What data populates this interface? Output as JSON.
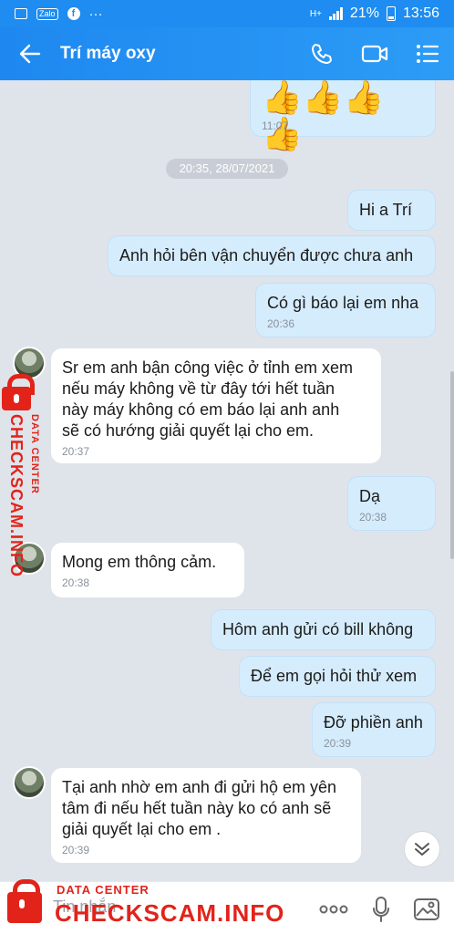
{
  "status_bar": {
    "battery": "21%",
    "time": "13:56",
    "network": "H+",
    "icons": [
      "gallery-icon",
      "zalo-icon",
      "facebook-icon",
      "more-dots-icon"
    ]
  },
  "header": {
    "title": "Trí máy oxy",
    "icons": [
      "back-arrow-icon",
      "phone-icon",
      "video-call-icon",
      "menu-list-icon"
    ]
  },
  "messages": [
    {
      "direction": "out",
      "content": "👍👍👍👍",
      "time": "11:07"
    },
    {
      "date_separator": "20:35, 28/07/2021"
    },
    {
      "direction": "out",
      "text": "Hi a Trí"
    },
    {
      "direction": "out",
      "text": "Anh hỏi bên vận chuyển được chưa anh"
    },
    {
      "direction": "out",
      "text": "Có gì báo lại em nha",
      "time": "20:36"
    },
    {
      "direction": "in",
      "lines": [
        "Sr em anh bận công việc ở tỉnh em xem",
        "nếu máy không về từ đây tới hết tuần",
        "này máy không có em báo lại anh anh",
        "sẽ có hướng giải quyết lại cho em."
      ],
      "time": "20:37"
    },
    {
      "direction": "out",
      "text": "Dạ",
      "time": "20:38"
    },
    {
      "direction": "in",
      "text": "Mong em thông cảm.",
      "time": "20:38"
    },
    {
      "direction": "out",
      "text": "Hôm anh gửi có bill không"
    },
    {
      "direction": "out",
      "text": "Để em gọi hỏi thử xem"
    },
    {
      "direction": "out",
      "text": "Đỡ phiền anh",
      "time": "20:39"
    },
    {
      "direction": "in",
      "lines": [
        "Tại anh nhờ em anh đi gửi hộ em yên",
        "tâm đi nếu hết tuần này ko có anh sẽ",
        "giải quyết lại cho em ."
      ],
      "time": "20:39"
    }
  ],
  "input": {
    "placeholder": "Tin nhắn",
    "icons": [
      "more-options-icon",
      "microphone-icon",
      "image-icon"
    ]
  },
  "watermark": {
    "vertical_small": "DATA CENTER",
    "vertical_large": "CHECKSCAM.INFO",
    "bottom_small": "DATA CENTER",
    "bottom_large": "CHECKSCAM.INFO"
  },
  "colors": {
    "header": "#1e88f0",
    "outgoing_bubble": "#d5ecfd",
    "incoming_bubble": "#ffffff",
    "background": "#dfe4ea",
    "watermark": "#e2231a"
  }
}
